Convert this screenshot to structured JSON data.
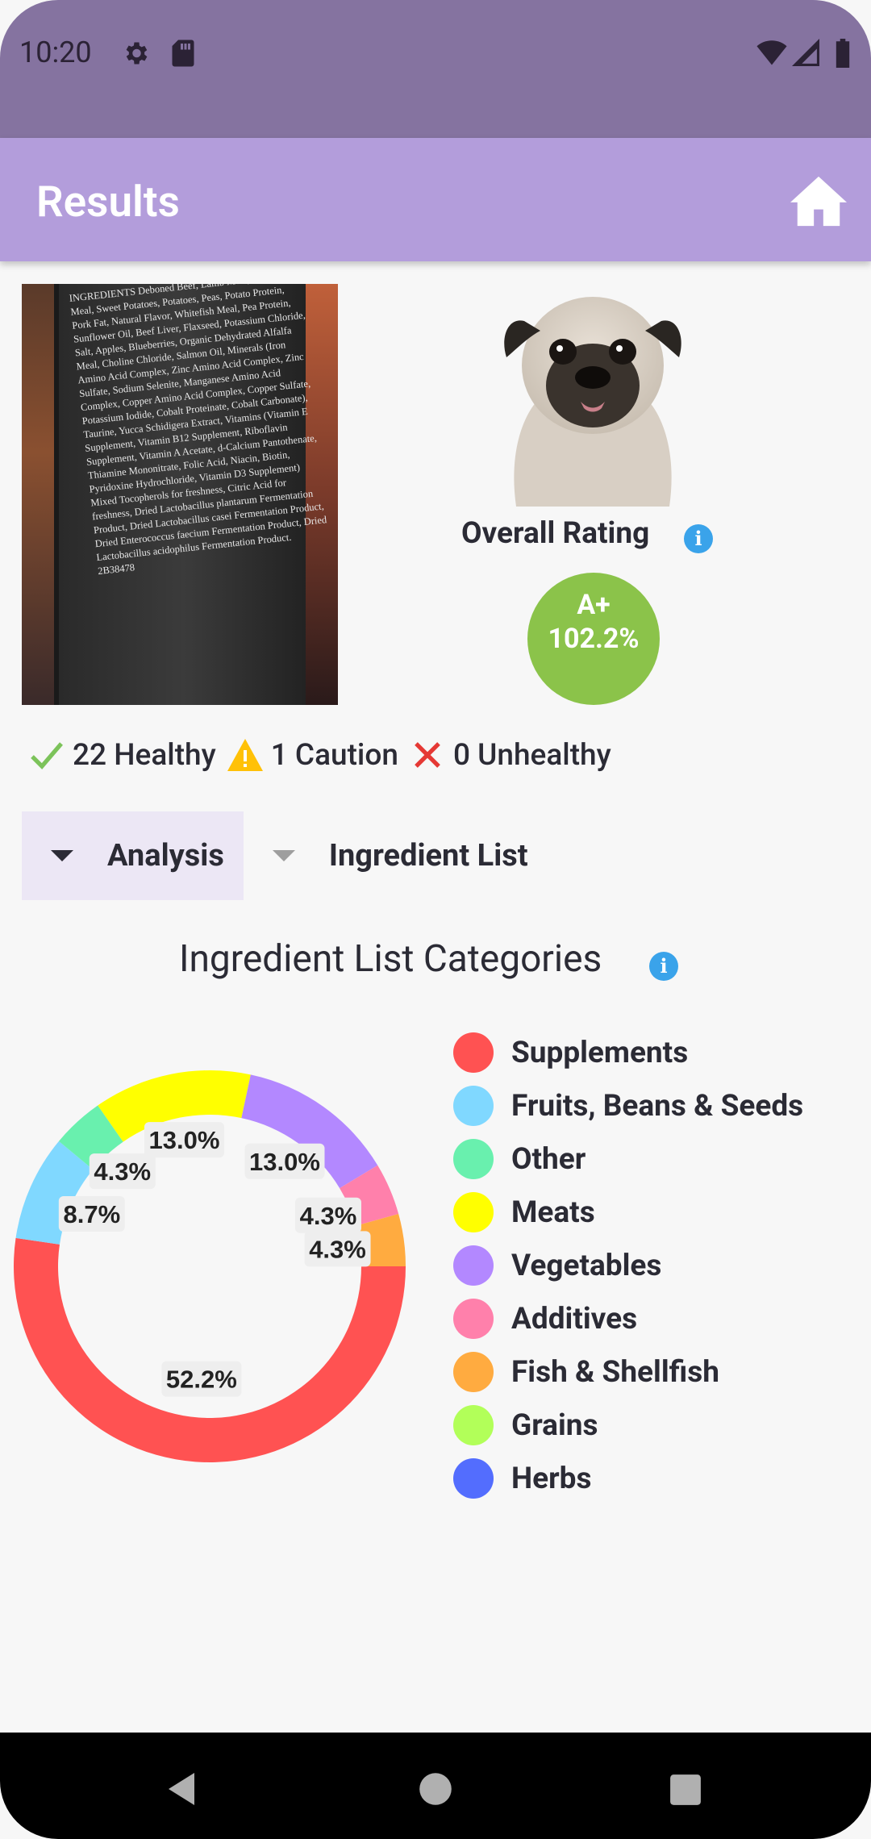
{
  "status_bar": {
    "time": "10:20"
  },
  "app_bar": {
    "title": "Results"
  },
  "ingredient_photo_text": "INGREDIENTS Deboned Beef, Lamb Meal, Salmon Meal, Sweet Potatoes, Potatoes, Peas, Potato Protein, Pork Fat, Natural Flavor, Whitefish Meal, Pea Protein, Sunflower Oil, Beef Liver, Flaxseed, Potassium Chloride, Salt, Apples, Blueberries, Organic Dehydrated Alfalfa Meal, Choline Chloride, Salmon Oil, Minerals (Iron Amino Acid Complex, Zinc Amino Acid Complex, Zinc Sulfate, Sodium Selenite, Manganese Amino Acid Complex, Copper Amino Acid Complex, Copper Sulfate, Potassium Iodide, Cobalt Proteinate, Cobalt Carbonate), Taurine, Yucca Schidigera Extract, Vitamins (Vitamin E Supplement, Vitamin B12 Supplement, Riboflavin Supplement, Vitamin A Acetate, d-Calcium Pantothenate, Thiamine Mononitrate, Folic Acid, Niacin, Biotin, Pyridoxine Hydrochloride, Vitamin D3 Supplement) Mixed Tocopherols for freshness, Citric Acid for freshness, Dried Lactobacillus plantarum Fermentation Product, Dried Lactobacillus casei Fermentation Product, Dried Enterococcus faecium Fermentation Product, Dried Lactobacillus acidophilus Fermentation Product. 2B38478",
  "rating": {
    "title": "Overall Rating",
    "grade": "A+",
    "percent": "102.2%"
  },
  "counts": {
    "healthy": "22 Healthy",
    "caution": "1 Caution",
    "unhealthy": "0 Unhealthy"
  },
  "tabs": [
    {
      "label": "Analysis",
      "active": true
    },
    {
      "label": "Ingredient List",
      "active": false
    }
  ],
  "chart_data": {
    "type": "pie",
    "title": "Ingredient List Categories",
    "series": [
      {
        "name": "Supplements",
        "value": 52.2,
        "label": "52.2%",
        "color": "#ff5252"
      },
      {
        "name": "Fruits, Beans & Seeds",
        "value": 8.7,
        "label": "8.7%",
        "color": "#80d8ff"
      },
      {
        "name": "Other",
        "value": 4.3,
        "label": "4.3%",
        "color": "#69f0ae"
      },
      {
        "name": "Meats",
        "value": 13.0,
        "label": "13.0%",
        "color": "#ffff00"
      },
      {
        "name": "Vegetables",
        "value": 13.0,
        "label": "13.0%",
        "color": "#b388ff"
      },
      {
        "name": "Additives",
        "value": 4.3,
        "label": "4.3%",
        "color": "#ff80ab"
      },
      {
        "name": "Fish & Shellfish",
        "value": 4.3,
        "label": "4.3%",
        "color": "#ffab40"
      },
      {
        "name": "Grains",
        "value": 0,
        "label": "",
        "color": "#b2ff59"
      },
      {
        "name": "Herbs",
        "value": 0,
        "label": "",
        "color": "#536dfe"
      }
    ],
    "legend_position": "right",
    "hole": "donut"
  },
  "icons": {
    "home": "home-icon",
    "info": "info-icon",
    "check": "check-icon",
    "warning": "warning-icon",
    "cross": "cross-icon"
  },
  "colors": {
    "status_bar": "#8573a0",
    "app_bar": "#b39ddb",
    "rating_circle": "#8bc34a",
    "info": "#3aa3ea"
  }
}
